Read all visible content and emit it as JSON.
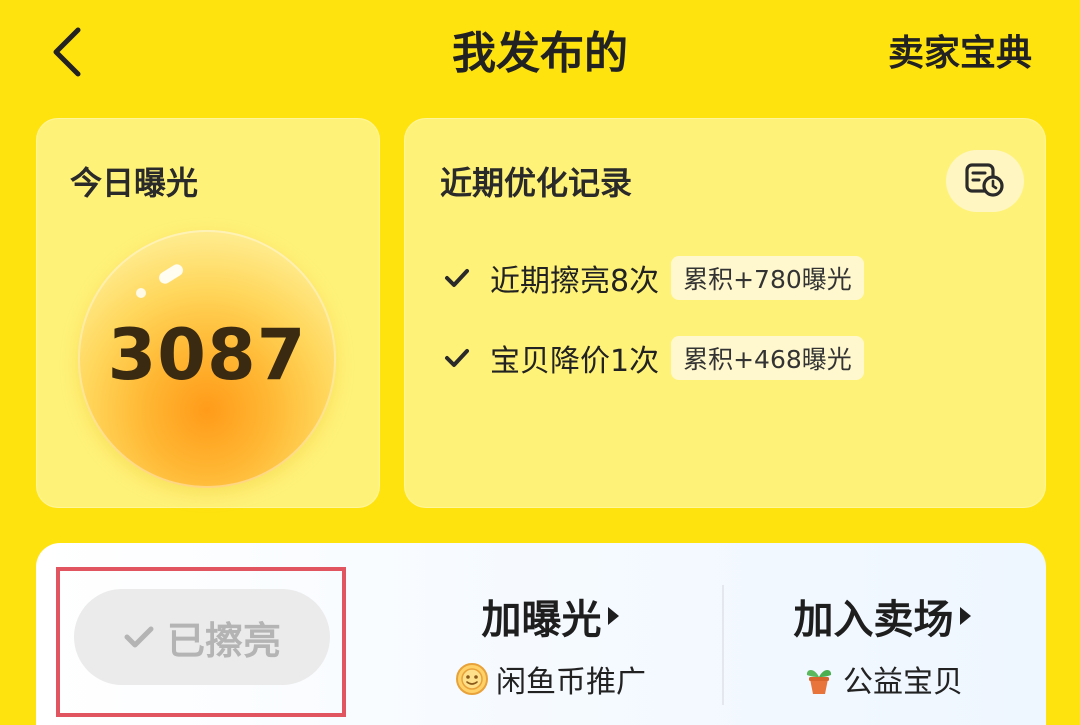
{
  "header": {
    "title": "我发布的",
    "right_link": "卖家宝典"
  },
  "exposure_card": {
    "label": "今日曝光",
    "value": "3087"
  },
  "history_card": {
    "title": "近期优化记录",
    "records": [
      {
        "text": "近期擦亮8次",
        "badge": "累积+780曝光"
      },
      {
        "text": "宝贝降价1次",
        "badge": "累积+468曝光"
      }
    ]
  },
  "actions": {
    "polished_label": "已擦亮",
    "boost": {
      "label": "加曝光",
      "sub": "闲鱼币推广"
    },
    "venue": {
      "label": "加入卖场",
      "sub": "公益宝贝"
    }
  },
  "colors": {
    "background": "#FFE30F",
    "highlight_border": "#E05560",
    "polished_text": "#B4B4B4"
  },
  "icons": {
    "back": "back-arrow-icon",
    "history": "calendar-clock-icon",
    "check": "check-icon",
    "coin": "xianyu-coin-icon",
    "plant": "potted-plant-icon"
  }
}
